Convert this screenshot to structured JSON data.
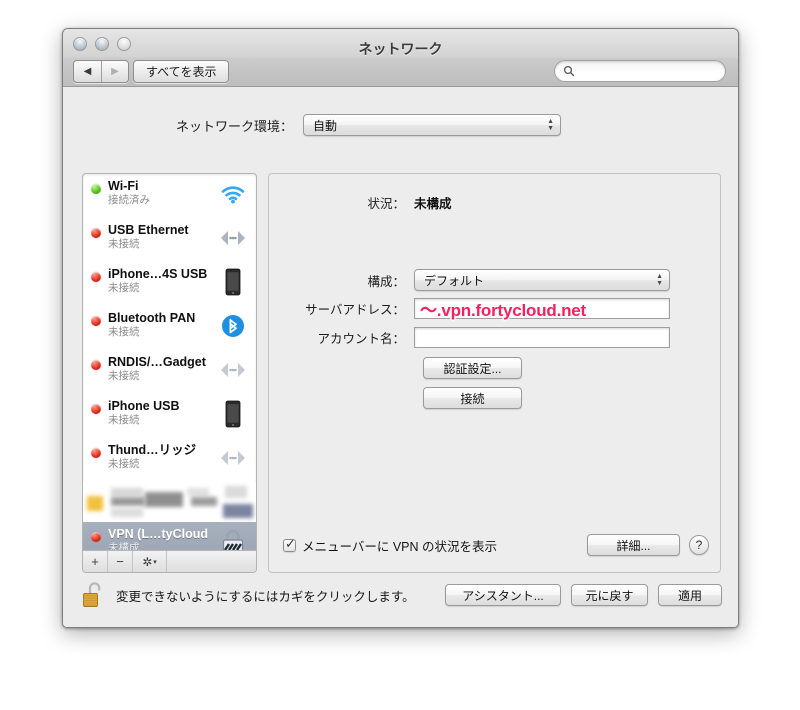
{
  "window": {
    "title": "ネットワーク",
    "traffic_lights": [
      "close-button",
      "minimize-button",
      "zoom-button"
    ],
    "back_glyph": "◀",
    "forward_glyph": "▶",
    "show_all_label": "すべてを表示",
    "search": {
      "value": "",
      "placeholder": "",
      "icon": "search-icon"
    }
  },
  "environment": {
    "label": "ネットワーク環境：",
    "value": "自動"
  },
  "services": [
    {
      "name": "Wi-Fi",
      "state": "接続済み",
      "dot": "green",
      "icon": "wifi-icon"
    },
    {
      "name": "USB Ethernet",
      "state": "未接続",
      "dot": "red",
      "icon": "ethernet-icon"
    },
    {
      "name": "iPhone…4S USB",
      "state": "未接続",
      "dot": "red",
      "icon": "iphone-icon"
    },
    {
      "name": "Bluetooth PAN",
      "state": "未接続",
      "dot": "red",
      "icon": "bluetooth-icon"
    },
    {
      "name": "RNDIS/…Gadget",
      "state": "未接続",
      "dot": "red",
      "icon": "ethernet-icon"
    },
    {
      "name": "iPhone USB",
      "state": "未接続",
      "dot": "red",
      "icon": "iphone-icon"
    },
    {
      "name": "Thund…リッジ",
      "state": "未接続",
      "dot": "red",
      "icon": "ethernet-icon"
    },
    {
      "name": "",
      "state": "",
      "dot": "none",
      "icon": "redacted",
      "redacted": true
    },
    {
      "name": "VPN (L…tyCloud",
      "state": "未構成",
      "dot": "red",
      "icon": "vpn-lock-icon",
      "selected": true
    }
  ],
  "service_toolbar": {
    "add_label": "+",
    "remove_label": "−",
    "gear_label": "✲",
    "gear_arrow": "▾"
  },
  "panel": {
    "status_label": "状況：",
    "status_value": "未構成",
    "config_label": "構成：",
    "config_value": "デフォルト",
    "server_label": "サーバアドレス：",
    "server_value": "〜.vpn.fortycloud.net",
    "account_label": "アカウント名：",
    "account_value": "",
    "auth_button": "認証設定...",
    "connect_button": "接続",
    "show_vpn_checkbox_label": "メニューバーに VPN の状況を表示",
    "show_vpn_checked": true,
    "advanced_button": "詳細...",
    "help_button": "?"
  },
  "footer": {
    "lock_icon": "unlocked-padlock-icon",
    "text": "変更できないようにするにはカギをクリックします。",
    "assistant_button": "アシスタント...",
    "revert_button": "元に戻す",
    "apply_button": "適用"
  },
  "colors": {
    "annotation": "#f4205f",
    "selection": "#9ea9b8",
    "status_connected": "#4cc114",
    "status_disconnected": "#e42718",
    "accent_blue": "#2fa0e8"
  }
}
